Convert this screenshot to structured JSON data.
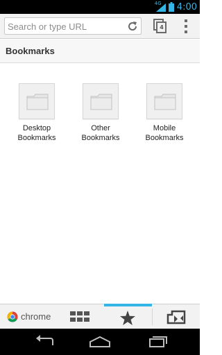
{
  "status_bar": {
    "network_type": "4G",
    "time": "4:00"
  },
  "toolbar": {
    "url_placeholder": "Search or type URL",
    "tab_count": "4",
    "icons": [
      "reload-icon",
      "tabs-icon",
      "overflow-menu-icon"
    ]
  },
  "header": {
    "title": "Bookmarks"
  },
  "folders": [
    {
      "label_line1": "Desktop",
      "label_line2": "Bookmarks"
    },
    {
      "label_line1": "Other",
      "label_line2": "Bookmarks"
    },
    {
      "label_line1": "Mobile",
      "label_line2": "Bookmarks"
    }
  ],
  "bottom_bar": {
    "brand": "chrome",
    "active_tab": "bookmarks",
    "tabs": [
      "most-visited",
      "bookmarks",
      "other-devices"
    ]
  },
  "nav_bar": {
    "buttons": [
      "back",
      "home",
      "recent-apps"
    ]
  },
  "colors": {
    "accent": "#33b5e5",
    "toolbar_bg": "#f2f2f2",
    "status_bg": "#000000"
  }
}
